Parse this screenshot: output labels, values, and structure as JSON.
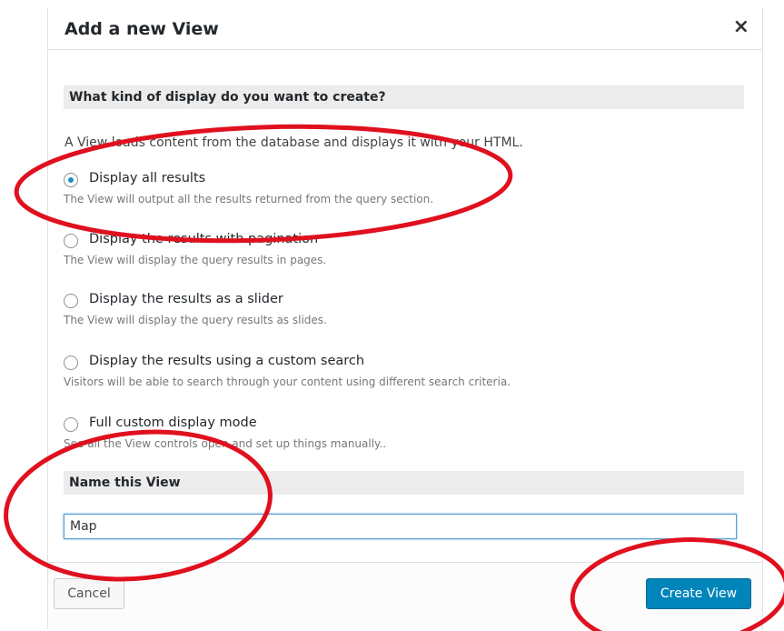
{
  "dialog": {
    "title": "Add a new View",
    "close_glyph": "×"
  },
  "display_section": {
    "heading": "What kind of display do you want to create?",
    "intro": "A View loads content from the database and displays it with your HTML."
  },
  "options": [
    {
      "label": "Display all results",
      "description": "The View will output all the results returned from the query section.",
      "checked": true
    },
    {
      "label": "Display the results with pagination",
      "description": "The View will display the query results in pages.",
      "checked": false
    },
    {
      "label": "Display the results as a slider",
      "description": "The View will display the query results as slides.",
      "checked": false
    },
    {
      "label": "Display the results using a custom search",
      "description": "Visitors will be able to search through your content using different search criteria.",
      "checked": false
    },
    {
      "label": "Full custom display mode",
      "description": "See all the View controls open and set up things manually..",
      "checked": false
    }
  ],
  "name_section": {
    "heading": "Name this View",
    "value": "Map"
  },
  "footer": {
    "cancel_label": "Cancel",
    "create_label": "Create View"
  },
  "colors": {
    "primary_button": "#0085ba",
    "annotation": "#e0101e",
    "radio_dot": "#1e8cbe"
  },
  "icons": [
    "close-icon"
  ]
}
